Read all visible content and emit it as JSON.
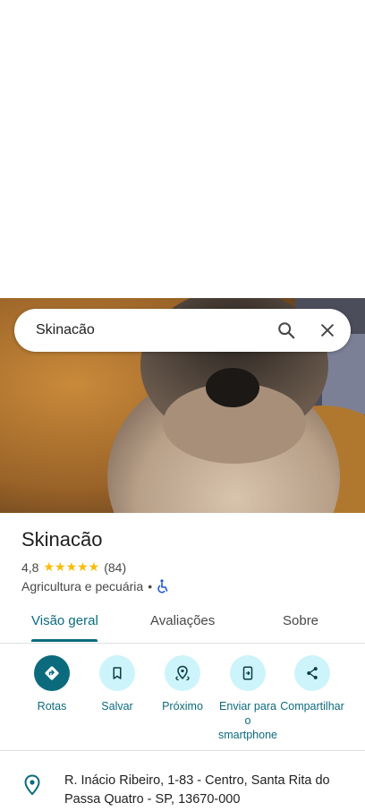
{
  "search": {
    "query": "Skinacão"
  },
  "place": {
    "name": "Skinacão",
    "rating": "4,8",
    "stars": "★★★★★",
    "review_count": "(84)",
    "category": "Agricultura e pecuária",
    "separator": "•"
  },
  "tabs": [
    {
      "label": "Visão geral"
    },
    {
      "label": "Avaliações"
    },
    {
      "label": "Sobre"
    }
  ],
  "actions": [
    {
      "label": "Rotas"
    },
    {
      "label": "Salvar"
    },
    {
      "label": "Próximo"
    },
    {
      "label": "Enviar para o smartphone"
    },
    {
      "label": "Compartilhar"
    }
  ],
  "address": "R. Inácio Ribeiro, 1-83 - Centro, Santa Rita do Passa Quatro - SP, 13670-000",
  "colors": {
    "accent": "#0b6b7d",
    "action_bg": "#cdf4fb",
    "star": "#fbbc04"
  }
}
